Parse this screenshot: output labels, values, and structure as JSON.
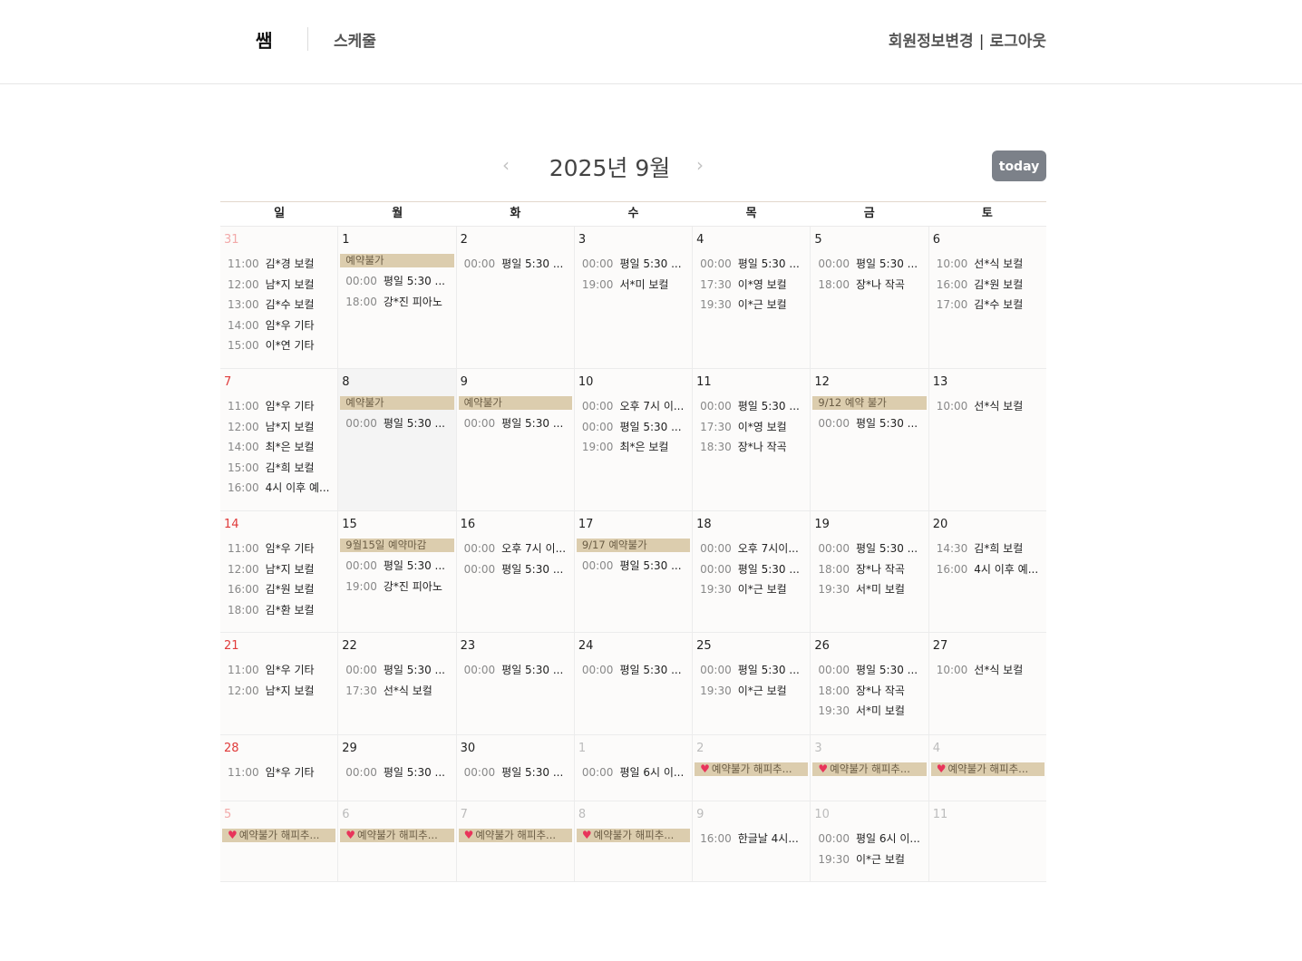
{
  "header": {
    "logo": "쌤",
    "nav_schedule": "스케줄",
    "profile_link": "회원정보변경",
    "separator": "|",
    "logout_link": "로그아웃"
  },
  "calendar": {
    "title": "2025년 9월",
    "prev_icon": "‹",
    "next_icon": "›",
    "today_label": "today",
    "weekdays": [
      "일",
      "월",
      "화",
      "수",
      "목",
      "금",
      "토"
    ],
    "heart_icon": "♥",
    "weeks": [
      [
        {
          "n": "31",
          "events": [
            [
              "11:00",
              "김*경 보컬"
            ],
            [
              "12:00",
              "남*지 보컬"
            ],
            [
              "13:00",
              "김*수 보컬"
            ],
            [
              "14:00",
              "임*우 기타"
            ],
            [
              "15:00",
              "이*연 기타"
            ]
          ]
        },
        {
          "n": "1",
          "banner": "예약불가",
          "events": [
            [
              "00:00",
              "평일 5:30 ..."
            ],
            [
              "18:00",
              "강*진 피아노"
            ]
          ]
        },
        {
          "n": "2",
          "events": [
            [
              "00:00",
              "평일 5:30 ..."
            ]
          ]
        },
        {
          "n": "3",
          "events": [
            [
              "00:00",
              "평일 5:30 ..."
            ],
            [
              "19:00",
              "서*미 보컬"
            ]
          ]
        },
        {
          "n": "4",
          "events": [
            [
              "00:00",
              "평일 5:30 ..."
            ],
            [
              "17:30",
              "이*영 보컬"
            ],
            [
              "19:30",
              "이*근 보컬"
            ]
          ]
        },
        {
          "n": "5",
          "events": [
            [
              "00:00",
              "평일 5:30 ..."
            ],
            [
              "18:00",
              "장*나 작곡"
            ]
          ]
        },
        {
          "n": "6",
          "events": [
            [
              "10:00",
              "선*식 보컬"
            ],
            [
              "16:00",
              "김*원 보컬"
            ],
            [
              "17:00",
              "김*수 보컬"
            ]
          ]
        }
      ],
      [
        {
          "n": "7",
          "events": [
            [
              "11:00",
              "임*우 기타"
            ],
            [
              "12:00",
              "남*지 보컬"
            ],
            [
              "14:00",
              "최*은 보컬"
            ],
            [
              "15:00",
              "김*희 보컬"
            ],
            [
              "16:00",
              "4시 이후 예..."
            ]
          ]
        },
        {
          "n": "8",
          "banner": "예약불가",
          "events": [
            [
              "00:00",
              "평일 5:30 ..."
            ]
          ]
        },
        {
          "n": "9",
          "banner": "예약불가",
          "events": [
            [
              "00:00",
              "평일 5:30 ..."
            ]
          ]
        },
        {
          "n": "10",
          "events": [
            [
              "00:00",
              "오후 7시 이..."
            ],
            [
              "00:00",
              "평일 5:30 ..."
            ],
            [
              "19:00",
              "최*은 보컬"
            ]
          ]
        },
        {
          "n": "11",
          "events": [
            [
              "00:00",
              "평일 5:30 ..."
            ],
            [
              "17:30",
              "이*영 보컬"
            ],
            [
              "18:30",
              "장*나 작곡"
            ]
          ]
        },
        {
          "n": "12",
          "banner": "9/12 예약 불가",
          "events": [
            [
              "00:00",
              "평일 5:30 ..."
            ]
          ]
        },
        {
          "n": "13",
          "events": [
            [
              "10:00",
              "선*식 보컬"
            ]
          ]
        }
      ],
      [
        {
          "n": "14",
          "events": [
            [
              "11:00",
              "임*우 기타"
            ],
            [
              "12:00",
              "남*지 보컬"
            ],
            [
              "16:00",
              "김*원 보컬"
            ],
            [
              "18:00",
              "김*환 보컬"
            ]
          ]
        },
        {
          "n": "15",
          "banner": "9월15일 예약마감",
          "events": [
            [
              "00:00",
              "평일 5:30 ..."
            ],
            [
              "19:00",
              "강*진 피아노"
            ]
          ]
        },
        {
          "n": "16",
          "events": [
            [
              "00:00",
              "오후 7시 이..."
            ],
            [
              "00:00",
              "평일 5:30 ..."
            ]
          ]
        },
        {
          "n": "17",
          "banner": "9/17 예약불가",
          "events": [
            [
              "00:00",
              "평일 5:30 ..."
            ]
          ]
        },
        {
          "n": "18",
          "events": [
            [
              "00:00",
              "오후 7시이..."
            ],
            [
              "00:00",
              "평일 5:30 ..."
            ],
            [
              "19:30",
              "이*근 보컬"
            ]
          ]
        },
        {
          "n": "19",
          "events": [
            [
              "00:00",
              "평일 5:30 ..."
            ],
            [
              "18:00",
              "장*나 작곡"
            ],
            [
              "19:30",
              "서*미 보컬"
            ]
          ]
        },
        {
          "n": "20",
          "events": [
            [
              "14:30",
              "김*희 보컬"
            ],
            [
              "16:00",
              "4시 이후 예..."
            ]
          ]
        }
      ],
      [
        {
          "n": "21",
          "events": [
            [
              "11:00",
              "임*우 기타"
            ],
            [
              "12:00",
              "남*지 보컬"
            ]
          ]
        },
        {
          "n": "22",
          "events": [
            [
              "00:00",
              "평일 5:30 ..."
            ],
            [
              "17:30",
              "선*식 보컬"
            ]
          ]
        },
        {
          "n": "23",
          "events": [
            [
              "00:00",
              "평일 5:30 ..."
            ]
          ]
        },
        {
          "n": "24",
          "events": [
            [
              "00:00",
              "평일 5:30 ..."
            ]
          ]
        },
        {
          "n": "25",
          "events": [
            [
              "00:00",
              "평일 5:30 ..."
            ],
            [
              "19:30",
              "이*근 보컬"
            ]
          ]
        },
        {
          "n": "26",
          "events": [
            [
              "00:00",
              "평일 5:30 ..."
            ],
            [
              "18:00",
              "장*나 작곡"
            ],
            [
              "19:30",
              "서*미 보컬"
            ]
          ]
        },
        {
          "n": "27",
          "events": [
            [
              "10:00",
              "선*식 보컬"
            ]
          ]
        }
      ],
      [
        {
          "n": "28",
          "events": [
            [
              "11:00",
              "임*우 기타"
            ]
          ]
        },
        {
          "n": "29",
          "events": [
            [
              "00:00",
              "평일 5:30 ..."
            ]
          ]
        },
        {
          "n": "30",
          "events": [
            [
              "00:00",
              "평일 5:30 ..."
            ]
          ]
        },
        {
          "n": "1",
          "events": [
            [
              "00:00",
              "평일 6시 이..."
            ]
          ]
        },
        {
          "n": "2",
          "banner": "예약불가 해피추...",
          "events": []
        },
        {
          "n": "3",
          "banner": "예약불가 해피추...",
          "events": []
        },
        {
          "n": "4",
          "banner": "예약불가 해피추...",
          "events": []
        }
      ],
      [
        {
          "n": "5",
          "banner": "예약불가 해피추...",
          "events": []
        },
        {
          "n": "6",
          "banner": "예약불가 해피추...",
          "events": []
        },
        {
          "n": "7",
          "banner": "예약불가 해피추...",
          "events": []
        },
        {
          "n": "8",
          "banner": "예약불가 해피추...",
          "events": []
        },
        {
          "n": "9",
          "events": [
            [
              "16:00",
              "한글날 4시..."
            ]
          ]
        },
        {
          "n": "10",
          "events": [
            [
              "00:00",
              "평일 6시 이..."
            ],
            [
              "19:30",
              "이*근 보컬"
            ]
          ]
        },
        {
          "n": "11",
          "events": []
        }
      ]
    ]
  }
}
